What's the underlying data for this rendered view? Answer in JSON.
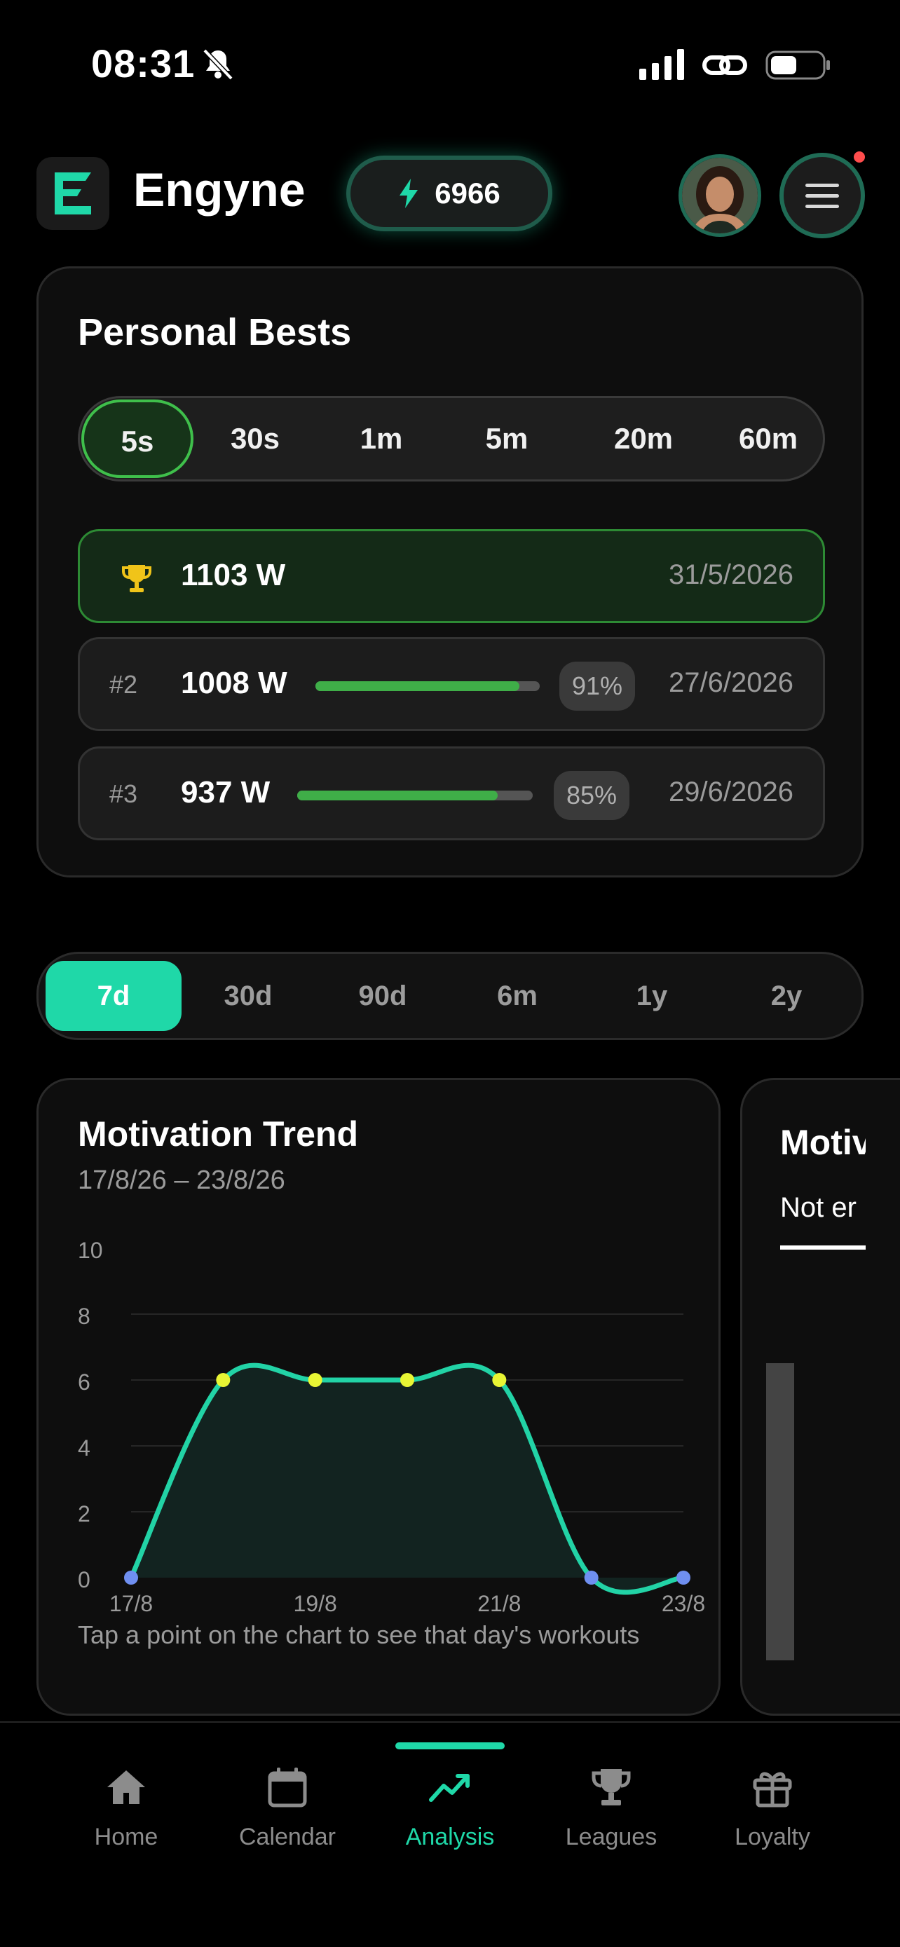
{
  "status_bar": {
    "time": "08:31"
  },
  "header": {
    "app_title": "Engyne",
    "points": "6966"
  },
  "personal_bests": {
    "title": "Personal Bests",
    "durations": [
      "5s",
      "30s",
      "1m",
      "5m",
      "20m",
      "60m"
    ],
    "selected_duration": "5s",
    "records": [
      {
        "rank": "",
        "watts": "1103 W",
        "date": "31/5/2026",
        "percent": "",
        "progress": 1.0
      },
      {
        "rank": "#2",
        "watts": "1008 W",
        "date": "27/6/2026",
        "percent": "91%",
        "progress": 0.91
      },
      {
        "rank": "#3",
        "watts": "937 W",
        "date": "29/6/2026",
        "percent": "85%",
        "progress": 0.85
      }
    ]
  },
  "period_tabs": [
    "7d",
    "30d",
    "90d",
    "6m",
    "1y",
    "2y"
  ],
  "selected_period": "7d",
  "motivation": {
    "title": "Motivation Trend",
    "range": "17/8/26 – 23/8/26",
    "hint": "Tap a point on the chart to see that day's workouts"
  },
  "chart_data": {
    "type": "area",
    "x": [
      "17/8",
      "18/8",
      "19/8",
      "20/8",
      "21/8",
      "22/8",
      "23/8"
    ],
    "tick_labels": [
      "17/8",
      "19/8",
      "21/8",
      "23/8"
    ],
    "values": [
      0,
      6,
      6,
      6,
      6,
      0,
      0
    ],
    "ylim": [
      0,
      10
    ],
    "yticks": [
      "0",
      "2",
      "4",
      "6",
      "8",
      "10"
    ],
    "grid": true,
    "colors": {
      "line": "#22d3a6",
      "point_active": "#e8f534",
      "point_zero": "#6f8ff0",
      "fill": "#122320"
    }
  },
  "motivation_card_2": {
    "title": "Motiv",
    "tab": "Not er"
  },
  "bottom_nav": {
    "items": [
      {
        "label": "Home",
        "icon": "home-icon"
      },
      {
        "label": "Calendar",
        "icon": "calendar-icon"
      },
      {
        "label": "Analysis",
        "icon": "trend-icon"
      },
      {
        "label": "Leagues",
        "icon": "trophy-icon"
      },
      {
        "label": "Loyalty",
        "icon": "gift-icon"
      }
    ],
    "active": "Analysis"
  },
  "colors": {
    "accent": "#1fd8a8",
    "pb_green": "#3fae48",
    "background": "#000000"
  }
}
